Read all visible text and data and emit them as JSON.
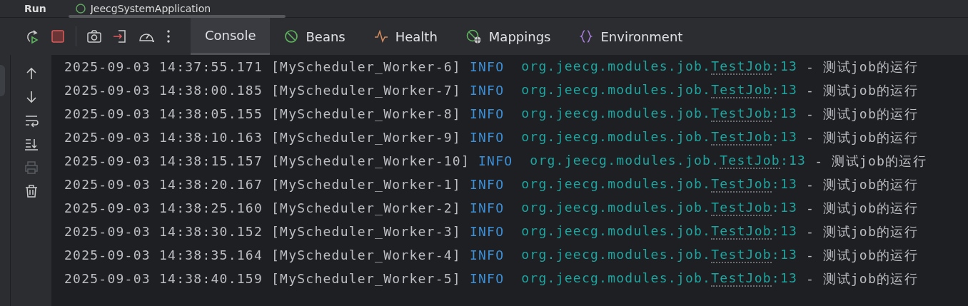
{
  "header": {
    "title": "Run",
    "run_tab": "JeecgSystemApplication"
  },
  "toolbar": {
    "actions": [
      {
        "kind": "rerun"
      },
      {
        "kind": "stop"
      },
      {
        "kind": "camera"
      },
      {
        "kind": "exit"
      },
      {
        "kind": "gauge"
      },
      {
        "kind": "more"
      }
    ]
  },
  "tabs": [
    {
      "label": "Console",
      "kind": "console",
      "selected": true
    },
    {
      "label": "Beans",
      "kind": "beans",
      "selected": false
    },
    {
      "label": "Health",
      "kind": "health",
      "selected": false
    },
    {
      "label": "Mappings",
      "kind": "mappings",
      "selected": false
    },
    {
      "label": "Environment",
      "kind": "environment",
      "selected": false
    }
  ],
  "gutter": [
    {
      "kind": "up",
      "disabled": false
    },
    {
      "kind": "down",
      "disabled": false
    },
    {
      "kind": "wrap",
      "disabled": false
    },
    {
      "kind": "scroll-end",
      "disabled": false
    },
    {
      "kind": "print",
      "disabled": true
    },
    {
      "kind": "trash",
      "disabled": false
    }
  ],
  "log": [
    {
      "time": "2025-09-03 14:37:55.171",
      "thread": "[MyScheduler_Worker-6]",
      "level": "INFO",
      "logger": "org.jeecg.modules.job.",
      "class": "TestJob",
      "line": ":13",
      "message": "- 测试job的运行"
    },
    {
      "time": "2025-09-03 14:38:00.185",
      "thread": "[MyScheduler_Worker-7]",
      "level": "INFO",
      "logger": "org.jeecg.modules.job.",
      "class": "TestJob",
      "line": ":13",
      "message": "- 测试job的运行"
    },
    {
      "time": "2025-09-03 14:38:05.155",
      "thread": "[MyScheduler_Worker-8]",
      "level": "INFO",
      "logger": "org.jeecg.modules.job.",
      "class": "TestJob",
      "line": ":13",
      "message": "- 测试job的运行"
    },
    {
      "time": "2025-09-03 14:38:10.163",
      "thread": "[MyScheduler_Worker-9]",
      "level": "INFO",
      "logger": "org.jeecg.modules.job.",
      "class": "TestJob",
      "line": ":13",
      "message": "- 测试job的运行"
    },
    {
      "time": "2025-09-03 14:38:15.157",
      "thread": "[MyScheduler_Worker-10]",
      "level": "INFO",
      "logger": "org.jeecg.modules.job.",
      "class": "TestJob",
      "line": ":13",
      "message": "- 测试job的运行"
    },
    {
      "time": "2025-09-03 14:38:20.167",
      "thread": "[MyScheduler_Worker-1]",
      "level": "INFO",
      "logger": "org.jeecg.modules.job.",
      "class": "TestJob",
      "line": ":13",
      "message": "- 测试job的运行"
    },
    {
      "time": "2025-09-03 14:38:25.160",
      "thread": "[MyScheduler_Worker-2]",
      "level": "INFO",
      "logger": "org.jeecg.modules.job.",
      "class": "TestJob",
      "line": ":13",
      "message": "- 测试job的运行"
    },
    {
      "time": "2025-09-03 14:38:30.152",
      "thread": "[MyScheduler_Worker-3]",
      "level": "INFO",
      "logger": "org.jeecg.modules.job.",
      "class": "TestJob",
      "line": ":13",
      "message": "- 测试job的运行"
    },
    {
      "time": "2025-09-03 14:38:35.164",
      "thread": "[MyScheduler_Worker-4]",
      "level": "INFO",
      "logger": "org.jeecg.modules.job.",
      "class": "TestJob",
      "line": ":13",
      "message": "- 测试job的运行"
    },
    {
      "time": "2025-09-03 14:38:40.159",
      "thread": "[MyScheduler_Worker-5]",
      "level": "INFO",
      "logger": "org.jeecg.modules.job.",
      "class": "TestJob",
      "line": ":13",
      "message": "- 测试job的运行"
    }
  ]
}
